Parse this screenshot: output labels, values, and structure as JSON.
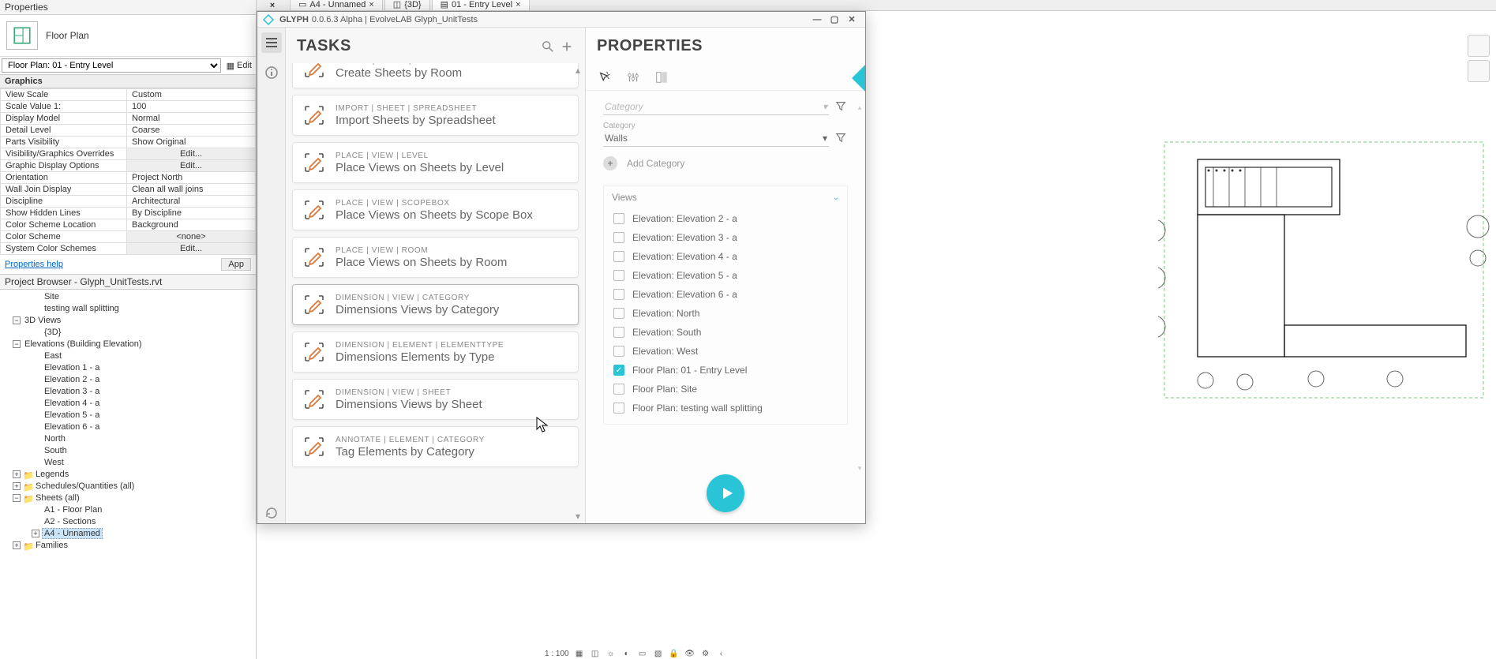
{
  "doc_tabs": [
    {
      "label": "A4 - Unnamed",
      "close": "×"
    },
    {
      "label": "{3D}",
      "close": ""
    },
    {
      "label": "01 - Entry Level",
      "close": "×",
      "active": true
    }
  ],
  "properties_palette": {
    "title": "Properties",
    "type_name": "Floor Plan",
    "selector": "Floor Plan: 01 - Entry Level",
    "edit_type_label": "Edit ",
    "section": "Graphics",
    "rows": [
      {
        "k": "View Scale",
        "v": "Custom"
      },
      {
        "k": "Scale Value    1:",
        "v": "100"
      },
      {
        "k": "Display Model",
        "v": "Normal"
      },
      {
        "k": "Detail Level",
        "v": "Coarse"
      },
      {
        "k": "Parts Visibility",
        "v": "Show Original"
      },
      {
        "k": "Visibility/Graphics Overrides",
        "v": "Edit...",
        "btn": true
      },
      {
        "k": "Graphic Display Options",
        "v": "Edit...",
        "btn": true
      },
      {
        "k": "Orientation",
        "v": "Project North"
      },
      {
        "k": "Wall Join Display",
        "v": "Clean all wall joins"
      },
      {
        "k": "Discipline",
        "v": "Architectural"
      },
      {
        "k": "Show Hidden Lines",
        "v": "By Discipline"
      },
      {
        "k": "Color Scheme Location",
        "v": "Background"
      },
      {
        "k": "Color Scheme",
        "v": "<none>",
        "btn": true
      },
      {
        "k": "System Color Schemes",
        "v": "Edit...",
        "btn": true
      }
    ],
    "help_link": "Properties help",
    "apply": "App"
  },
  "project_browser": {
    "title": "Project Browser - Glyph_UnitTests.rvt",
    "tree": {
      "site": "Site",
      "twall": "testing wall splitting",
      "views3d": "3D Views",
      "view3d_item": "{3D}",
      "elev_group": "Elevations (Building Elevation)",
      "elevs": [
        "East",
        "Elevation 1 - a",
        "Elevation 2 - a",
        "Elevation 3 - a",
        "Elevation 4 - a",
        "Elevation 5 - a",
        "Elevation 6 - a",
        "North",
        "South",
        "West"
      ],
      "legends": "Legends",
      "schedules": "Schedules/Quantities (all)",
      "sheets": "Sheets (all)",
      "sheet_items": [
        "A1 - Floor Plan",
        "A2 - Sections",
        "A4 - Unnamed"
      ],
      "families": "Families"
    }
  },
  "glyph": {
    "title_app": "GLYPH",
    "title_ver": "0.0.6.3 Alpha | EvolveLAB  Glyph_UnitTests",
    "tasks_header": "TASKS",
    "props_header": "PROPERTIES",
    "tasks": [
      {
        "crumbs": "CREATE  |  SHEET  |  ROOM",
        "name": "Create Sheets by Room",
        "cut": true
      },
      {
        "crumbs": "IMPORT  |  SHEET  |  SPREADSHEET",
        "name": "Import Sheets by Spreadsheet"
      },
      {
        "crumbs": "PLACE  |  VIEW  |  LEVEL",
        "name": "Place Views on Sheets by Level"
      },
      {
        "crumbs": "PLACE  |  VIEW  |  SCOPEBOX",
        "name": "Place Views on Sheets by Scope Box"
      },
      {
        "crumbs": "PLACE  |  VIEW  |  ROOM",
        "name": "Place Views on Sheets by Room"
      },
      {
        "crumbs": "DIMENSION  |  VIEW  |  CATEGORY",
        "name": "Dimensions Views by Category",
        "selected": true
      },
      {
        "crumbs": "DIMENSION  |  ELEMENT  |  ELEMENTTYPE",
        "name": "Dimensions Elements by Type"
      },
      {
        "crumbs": "DIMENSION  |  VIEW  |  SHEET",
        "name": "Dimensions Views by Sheet"
      },
      {
        "crumbs": "ANNOTATE  |  ELEMENT  |  CATEGORY",
        "name": "Tag Elements by Category"
      }
    ],
    "cat_placeholder": "Category",
    "cat2_label": "Category",
    "cat2_value": "Walls",
    "add_category": "Add Category",
    "views_label": "Views",
    "views": [
      {
        "label": "Elevation: Elevation 2 - a",
        "checked": false
      },
      {
        "label": "Elevation: Elevation 3 - a",
        "checked": false
      },
      {
        "label": "Elevation: Elevation 4 - a",
        "checked": false
      },
      {
        "label": "Elevation: Elevation 5 - a",
        "checked": false
      },
      {
        "label": "Elevation: Elevation 6 - a",
        "checked": false
      },
      {
        "label": "Elevation: North",
        "checked": false
      },
      {
        "label": "Elevation: South",
        "checked": false
      },
      {
        "label": "Elevation: West",
        "checked": false
      },
      {
        "label": "Floor Plan: 01 - Entry Level",
        "checked": true
      },
      {
        "label": "Floor Plan: Site",
        "checked": false
      },
      {
        "label": "Floor Plan: testing wall splitting",
        "checked": false
      }
    ]
  },
  "view_bar_scale": "1 : 100"
}
